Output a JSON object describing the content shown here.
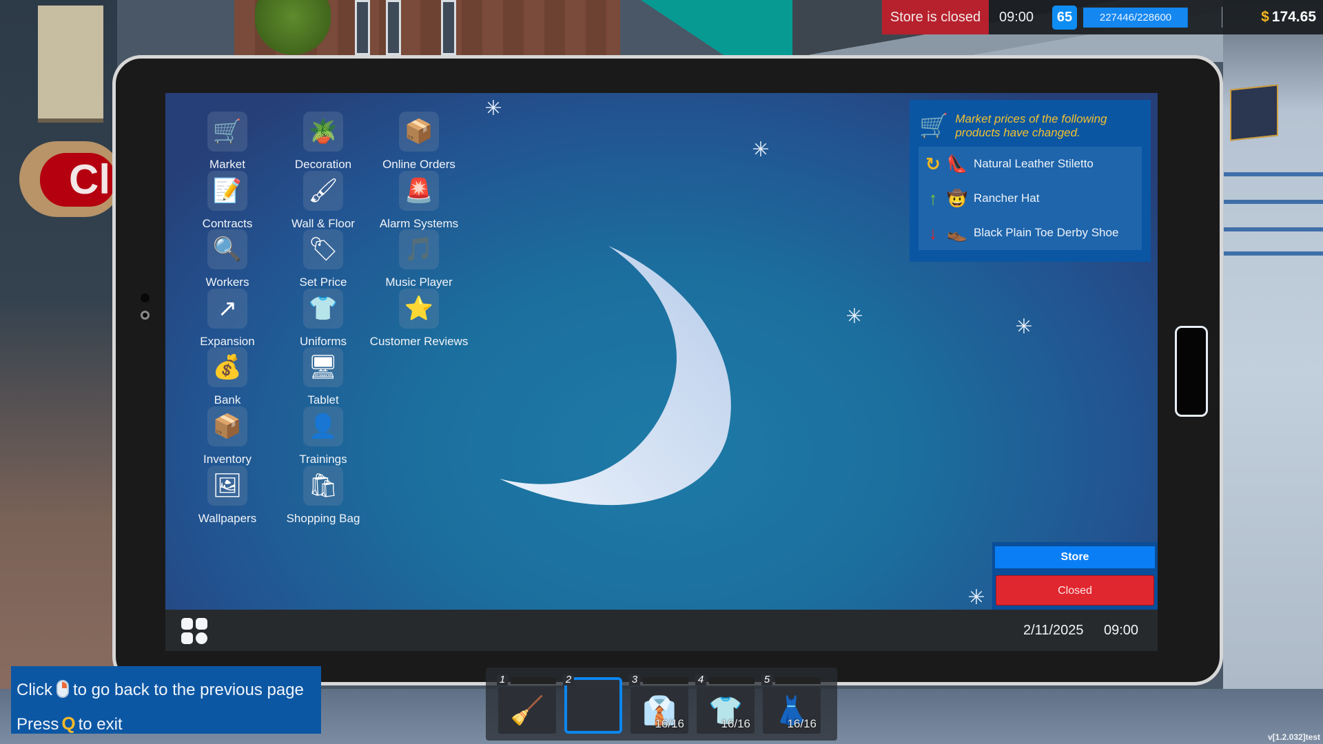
{
  "hud": {
    "store_status": "Store is closed",
    "time": "09:00",
    "level": "65",
    "xp_text": "227446/228600",
    "xp_current": 227446,
    "xp_max": 228600,
    "currency_symbol": "$",
    "money": "174.65"
  },
  "background_sign": "Cl",
  "apps": [
    {
      "label": "Market",
      "icon": "🛒",
      "icon_name": "shopping-cart-icon"
    },
    {
      "label": "Decoration",
      "icon": "🪴",
      "icon_name": "decoration-icon"
    },
    {
      "label": "Online Orders",
      "icon": "📦",
      "icon_name": "package-icon"
    },
    {
      "label": "Contracts",
      "icon": "📝",
      "icon_name": "contract-document-icon"
    },
    {
      "label": "Wall & Floor",
      "icon": "🖌",
      "icon_name": "paint-roller-icon"
    },
    {
      "label": "Alarm Systems",
      "icon": "🚨",
      "icon_name": "alarm-siren-icon"
    },
    {
      "label": "Workers",
      "icon": "🔍",
      "icon_name": "worker-search-icon"
    },
    {
      "label": "Set Price",
      "icon": "🏷",
      "icon_name": "price-tag-icon"
    },
    {
      "label": "Music Player",
      "icon": "🎵",
      "icon_name": "music-notes-icon"
    },
    {
      "label": "Expansion",
      "icon": "↗",
      "icon_name": "expansion-icon"
    },
    {
      "label": "Uniforms",
      "icon": "👕",
      "icon_name": "uniform-shirt-icon"
    },
    {
      "label": "Customer Reviews",
      "icon": "⭐",
      "icon_name": "star-icon"
    },
    {
      "label": "Bank",
      "icon": "💰",
      "icon_name": "bank-money-icon"
    },
    {
      "label": "Tablet",
      "icon": "🖥",
      "icon_name": "tablet-devices-icon"
    },
    {
      "label": "Inventory",
      "icon": "📦",
      "icon_name": "inventory-boxes-icon"
    },
    {
      "label": "Trainings",
      "icon": "👤",
      "icon_name": "training-icon"
    },
    {
      "label": "Wallpapers",
      "icon": "🖼",
      "icon_name": "wallpaper-image-icon"
    },
    {
      "label": "Shopping Bag",
      "icon": "🛍",
      "icon_name": "shopping-bag-icon"
    }
  ],
  "notification": {
    "message": "Market prices of the following products have changed.",
    "items": [
      {
        "name": "Natural Leather Stiletto",
        "trend": "reset",
        "trend_glyph": "↻",
        "trend_color": "#f5b820",
        "product_glyph": "👠"
      },
      {
        "name": "Rancher Hat",
        "trend": "up",
        "trend_glyph": "↑",
        "trend_color": "#7cc431",
        "product_glyph": "🤠"
      },
      {
        "name": "Black Plain Toe Derby Shoe",
        "trend": "down",
        "trend_glyph": "↓",
        "trend_color": "#e2232b",
        "product_glyph": "👞"
      }
    ]
  },
  "store_toggle": {
    "title": "Store",
    "state": "Closed"
  },
  "taskbar": {
    "date": "2/11/2025",
    "time": "09:00"
  },
  "hints": {
    "line1_before": "Click",
    "line1_after": "to go back to the previous page",
    "line2_before": "Press",
    "line2_key": "Q",
    "line2_after": "to exit"
  },
  "hotbar": [
    {
      "num": "1",
      "item": "squeegee",
      "glyph": "🧹",
      "count": "",
      "active": false
    },
    {
      "num": "2",
      "item": "empty",
      "glyph": "",
      "count": "",
      "active": true
    },
    {
      "num": "3",
      "item": "denim shirt",
      "glyph": "👔",
      "count": "16/16",
      "active": false
    },
    {
      "num": "4",
      "item": "green t-shirt",
      "glyph": "👕",
      "count": "16/16",
      "active": false
    },
    {
      "num": "5",
      "item": "blue dress",
      "glyph": "👗",
      "count": "16/16",
      "active": false
    }
  ],
  "version": "v[1.2.032]test",
  "colors": {
    "accent_blue": "#0a7ef5",
    "closed_red": "#e0262e",
    "money_gold": "#f4b620",
    "notif_text": "#f3c130"
  }
}
